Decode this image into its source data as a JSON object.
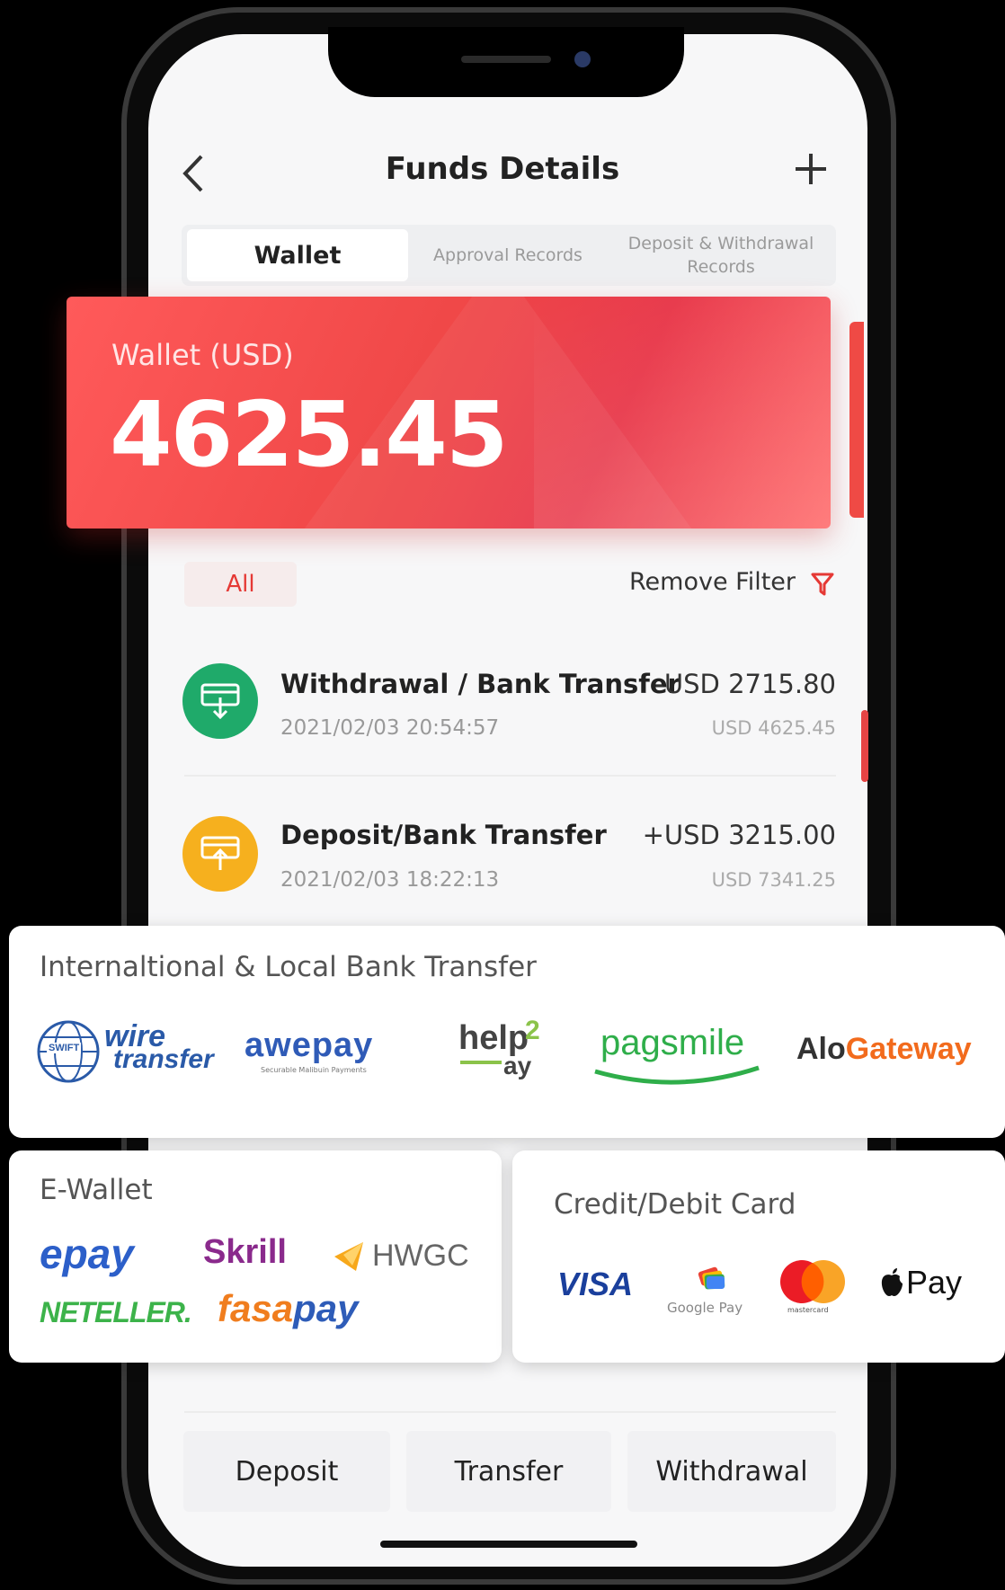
{
  "header": {
    "title": "Funds Details"
  },
  "tabs": [
    {
      "label": "Wallet"
    },
    {
      "label": "Approval Records"
    },
    {
      "label": "Deposit & Withdrawal Records"
    }
  ],
  "wallet": {
    "label": "Wallet (USD)",
    "amount": "4625.45"
  },
  "filter": {
    "chip": "All",
    "remove_label": "Remove Filter"
  },
  "transactions": [
    {
      "title": "Withdrawal / Bank Transfer",
      "date": "2021/02/03 20:54:57",
      "amount": "-USD 2715.80",
      "balance": "USD 4625.45",
      "icon": "withdraw-icon",
      "color": "#1faa6a"
    },
    {
      "title": "Deposit/Bank Transfer",
      "date": "2021/02/03 18:22:13",
      "amount": "+USD 3215.00",
      "balance": "USD 7341.25",
      "icon": "deposit-icon",
      "color": "#f6b01e"
    }
  ],
  "bank_transfer": {
    "title": "Internaltional & Local Bank Transfer",
    "logos": {
      "swift": "SWIFT",
      "wire_1": "wire",
      "wire_2": "transfer",
      "awepay": "awepay",
      "awepay_sub": "Securable Malibuin Payments",
      "help2pay_1": "help",
      "help2pay_2": "2",
      "help2pay_3": "ay",
      "pagsmile": "pagsmile",
      "alo_1": "Alo",
      "alo_2": "Gateway"
    }
  },
  "ewallet": {
    "title": "E-Wallet",
    "logos": {
      "epay": "epay",
      "skrill": "Skrill",
      "hwgc": "HWGC",
      "neteller": "NETELLER.",
      "fasa": "fasa",
      "pay": "pay"
    }
  },
  "card": {
    "title": "Credit/Debit Card",
    "logos": {
      "visa": "VISA",
      "gpay": "Google Pay",
      "mastercard": "mastercard",
      "apple": "Pay"
    }
  },
  "actions": {
    "deposit": "Deposit",
    "transfer": "Transfer",
    "withdrawal": "Withdrawal"
  },
  "colors": {
    "accent": "#e53935",
    "green": "#1faa6a",
    "orange": "#f6b01e"
  }
}
